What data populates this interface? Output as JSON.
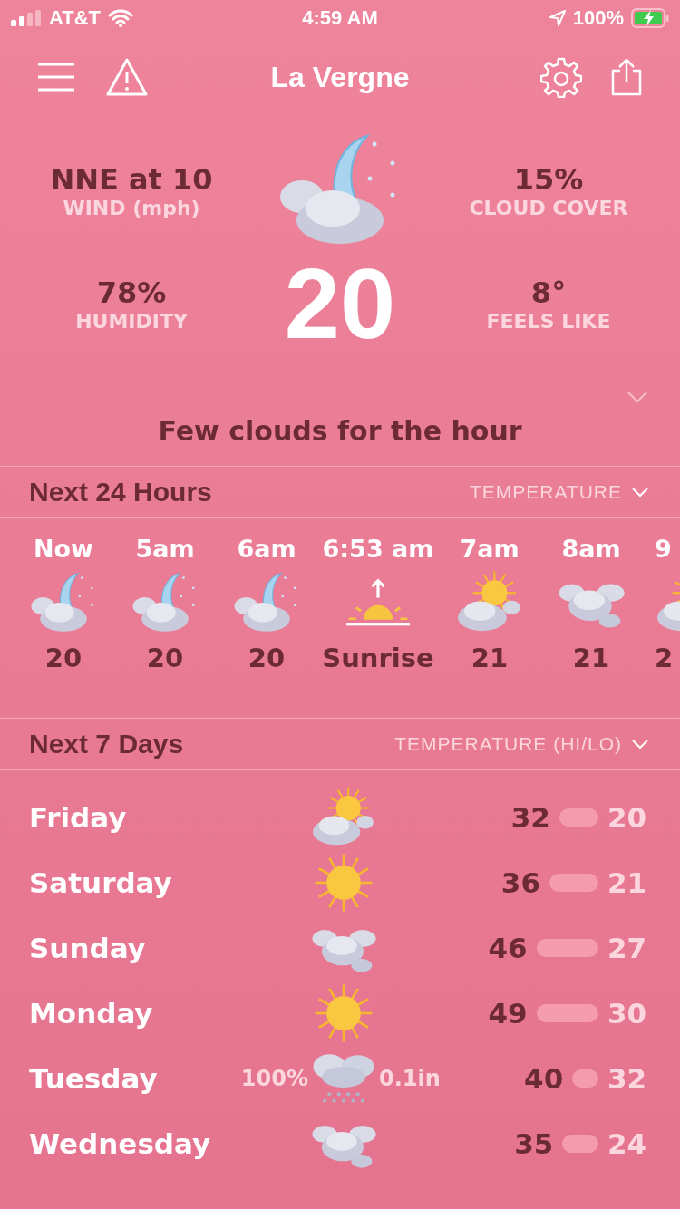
{
  "status_bar": {
    "carrier": "AT&T",
    "time": "4:59 AM",
    "battery": "100%"
  },
  "nav": {
    "title": "La Vergne"
  },
  "current": {
    "kind": "moon-cloud",
    "temperature": "20",
    "summary": "Few clouds for the hour",
    "stats": [
      {
        "value": "NNE at 10",
        "label": "WIND (mph)"
      },
      {
        "value": "15%",
        "label": "CLOUD COVER"
      },
      {
        "value": "78%",
        "label": "HUMIDITY"
      },
      {
        "value": "8°",
        "label": "FEELS LIKE"
      }
    ]
  },
  "hourly": {
    "title": "Next 24 Hours",
    "selector": "TEMPERATURE",
    "hours": [
      {
        "time": "Now",
        "kind": "moon-cloud",
        "value": "20"
      },
      {
        "time": "5am",
        "kind": "moon-cloud",
        "value": "20"
      },
      {
        "time": "6am",
        "kind": "moon-cloud",
        "value": "20"
      },
      {
        "time": "6:53 am",
        "kind": "sunrise",
        "value": "Sunrise"
      },
      {
        "time": "7am",
        "kind": "sun-cloud",
        "value": "21"
      },
      {
        "time": "8am",
        "kind": "clouds",
        "value": "21"
      },
      {
        "time": "9",
        "kind": "sun-cloud",
        "value": "2"
      }
    ]
  },
  "daily": {
    "title": "Next 7 Days",
    "selector": "TEMPERATURE (HI/LO)",
    "days": [
      {
        "day": "Friday",
        "kind": "sun-cloud",
        "high": "32",
        "low": "20"
      },
      {
        "day": "Saturday",
        "kind": "sun",
        "high": "36",
        "low": "21"
      },
      {
        "day": "Sunday",
        "kind": "clouds",
        "high": "46",
        "low": "27"
      },
      {
        "day": "Monday",
        "kind": "sun",
        "high": "49",
        "low": "30"
      },
      {
        "day": "Tuesday",
        "kind": "snow-cloud",
        "precip_chance": "100%",
        "precip_amount": "0.1in",
        "high": "40",
        "low": "32"
      },
      {
        "day": "Wednesday",
        "kind": "clouds",
        "high": "35",
        "low": "24"
      }
    ]
  }
}
